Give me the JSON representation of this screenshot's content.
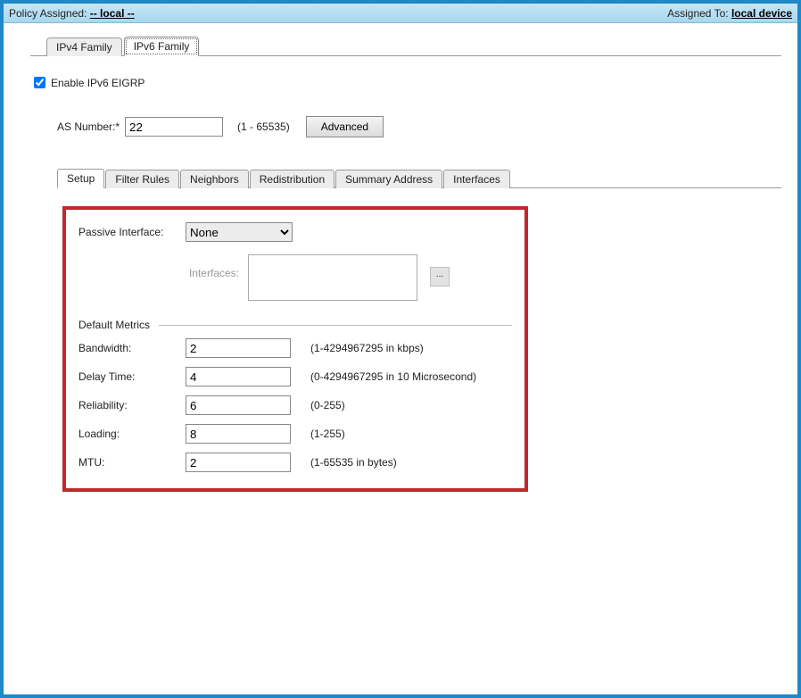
{
  "titlebar": {
    "policy_assigned_label": "Policy Assigned:",
    "policy_assigned_value": "-- local --",
    "assigned_to_label": "Assigned To:",
    "assigned_to_value": "local device"
  },
  "outer_tabs": {
    "ipv4": "IPv4 Family",
    "ipv6": "IPv6 Family",
    "active": "ipv6"
  },
  "enable": {
    "label": "Enable IPv6 EIGRP",
    "checked": true
  },
  "as_number": {
    "label": "AS Number:*",
    "value": "22",
    "hint": "(1 - 65535)",
    "advanced_btn": "Advanced"
  },
  "subtabs": {
    "items": [
      "Setup",
      "Filter Rules",
      "Neighbors",
      "Redistribution",
      "Summary Address",
      "Interfaces"
    ],
    "active_index": 0
  },
  "passive_interface": {
    "label": "Passive Interface:",
    "value": "None"
  },
  "interfaces": {
    "label": "Interfaces:",
    "browse_label": "..."
  },
  "default_metrics": {
    "title": "Default Metrics",
    "bandwidth": {
      "label": "Bandwidth:",
      "value": "2",
      "hint": "(1-4294967295 in kbps)"
    },
    "delay": {
      "label": "Delay Time:",
      "value": "4",
      "hint": "(0-4294967295 in 10 Microsecond)"
    },
    "reliability": {
      "label": "Reliability:",
      "value": "6",
      "hint": "(0-255)"
    },
    "loading": {
      "label": "Loading:",
      "value": "8",
      "hint": "(1-255)"
    },
    "mtu": {
      "label": "MTU:",
      "value": "2",
      "hint": "(1-65535 in bytes)"
    }
  }
}
